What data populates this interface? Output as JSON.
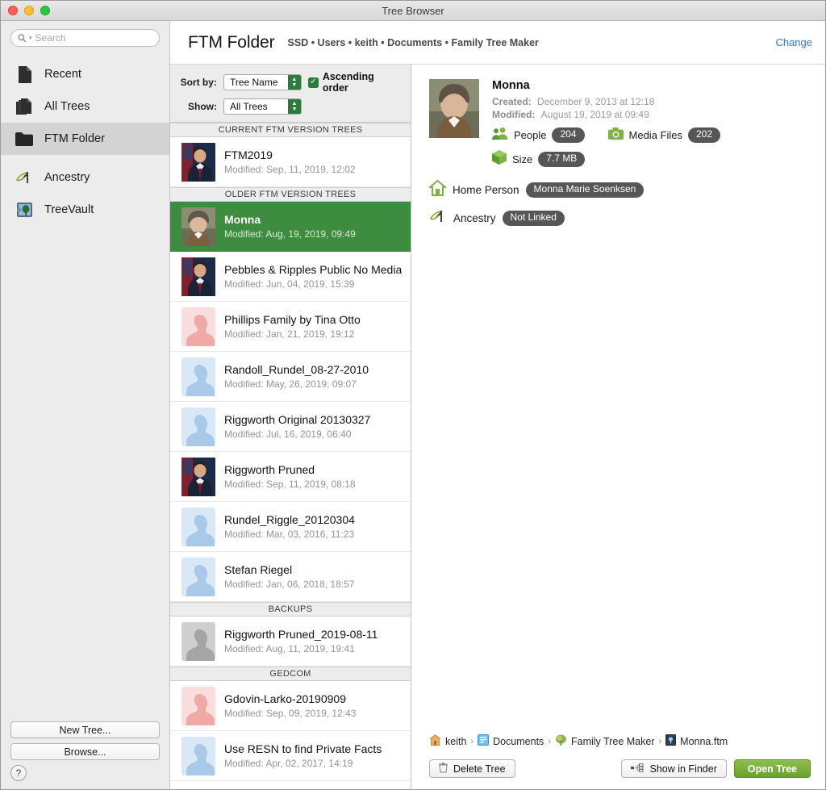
{
  "window": {
    "title": "Tree Browser"
  },
  "sidebar": {
    "search": {
      "placeholder": "Search",
      "value": ""
    },
    "groups": [
      {
        "items": [
          {
            "label": "Recent",
            "icon": "document-icon",
            "selected": false
          },
          {
            "label": "All Trees",
            "icon": "documents-stack-icon",
            "selected": false
          },
          {
            "label": "FTM Folder",
            "icon": "folder-icon",
            "selected": true
          }
        ]
      },
      {
        "items": [
          {
            "label": "Ancestry",
            "icon": "ancestry-leaf-icon",
            "selected": false
          },
          {
            "label": "TreeVault",
            "icon": "treevault-icon",
            "selected": false
          }
        ]
      }
    ],
    "new_tree_label": "New Tree...",
    "browse_label": "Browse...",
    "help_label": "?"
  },
  "header": {
    "title": "FTM Folder",
    "path": "SSD • Users • keith • Documents • Family Tree Maker",
    "change_label": "Change"
  },
  "sortbar": {
    "sort_by_label": "Sort by:",
    "sort_by_value": "Tree Name",
    "show_label": "Show:",
    "show_value": "All Trees",
    "ascending_label": "Ascending order",
    "ascending_checked": true,
    "checkmark": "✓"
  },
  "list": {
    "sections": [
      {
        "header": "CURRENT FTM VERSION TREES",
        "rows": [
          {
            "name": "FTM2019",
            "modified": "Modified: Sep, 11, 2019, 12:02",
            "avatar": "photo-man",
            "selected": false
          }
        ]
      },
      {
        "header": "OLDER FTM VERSION TREES",
        "rows": [
          {
            "name": "Monna",
            "modified": "Modified: Aug, 19, 2019, 09:49",
            "avatar": "photo-woman",
            "selected": true
          },
          {
            "name": "Pebbles & Ripples Public No Media",
            "modified": "Modified: Jun, 04, 2019, 15:39",
            "avatar": "photo-man",
            "selected": false
          },
          {
            "name": "Phillips Family by Tina Otto",
            "modified": "Modified: Jan, 21, 2019, 19:12",
            "avatar": "silhouette-pink",
            "selected": false
          },
          {
            "name": "Randoll_Rundel_08-27-2010",
            "modified": "Modified: May, 26, 2019, 09:07",
            "avatar": "silhouette-blue",
            "selected": false
          },
          {
            "name": "Riggworth Original 20130327",
            "modified": "Modified: Jul, 16, 2019, 06:40",
            "avatar": "silhouette-blue",
            "selected": false
          },
          {
            "name": "Riggworth Pruned",
            "modified": "Modified: Sep, 11, 2019, 08:18",
            "avatar": "photo-man",
            "selected": false
          },
          {
            "name": "Rundel_Riggle_20120304",
            "modified": "Modified: Mar, 03, 2016, 11:23",
            "avatar": "silhouette-blue",
            "selected": false
          },
          {
            "name": "Stefan Riegel",
            "modified": "Modified: Jan, 06, 2018, 18:57",
            "avatar": "silhouette-blue",
            "selected": false
          }
        ]
      },
      {
        "header": "BACKUPS",
        "rows": [
          {
            "name": "Riggworth Pruned_2019-08-11",
            "modified": "Modified: Aug, 11, 2019, 19:41",
            "avatar": "silhouette-gray",
            "selected": false
          }
        ]
      },
      {
        "header": "GEDCOM",
        "rows": [
          {
            "name": "Gdovin-Larko-20190909",
            "modified": "Modified: Sep, 09, 2019, 12:43",
            "avatar": "silhouette-pink",
            "selected": false
          },
          {
            "name": "Use RESN to find Private Facts",
            "modified": "Modified: Apr, 02, 2017, 14:19",
            "avatar": "silhouette-blue",
            "selected": false
          }
        ]
      }
    ]
  },
  "detail": {
    "name": "Monna",
    "created_label": "Created:",
    "created_value": "December 9, 2013 at 12:18",
    "modified_label": "Modified:",
    "modified_value": "August 19, 2019 at 09:49",
    "people_label": "People",
    "people_count": "204",
    "media_label": "Media Files",
    "media_count": "202",
    "size_label": "Size",
    "size_value": "7.7 MB",
    "home_person_label": "Home Person",
    "home_person_value": "Monna Marie Soenksen",
    "ancestry_label": "Ancestry",
    "ancestry_value": "Not Linked"
  },
  "pathbar": {
    "items": [
      {
        "label": "keith",
        "icon": "home-icon"
      },
      {
        "label": "Documents",
        "icon": "documents-folder-icon"
      },
      {
        "label": "Family Tree Maker",
        "icon": "ftm-app-icon"
      },
      {
        "label": "Monna.ftm",
        "icon": "ftm-file-icon"
      }
    ],
    "separator": "›"
  },
  "footer": {
    "delete_label": "Delete Tree",
    "show_finder_label": "Show in Finder",
    "open_tree_label": "Open Tree"
  },
  "colors": {
    "selection_green": "#3d8c3f",
    "accent_green": "#6ca02e",
    "link_blue": "#3b73d6",
    "pill_gray": "#565656",
    "control_green": "#2d7a3e"
  }
}
